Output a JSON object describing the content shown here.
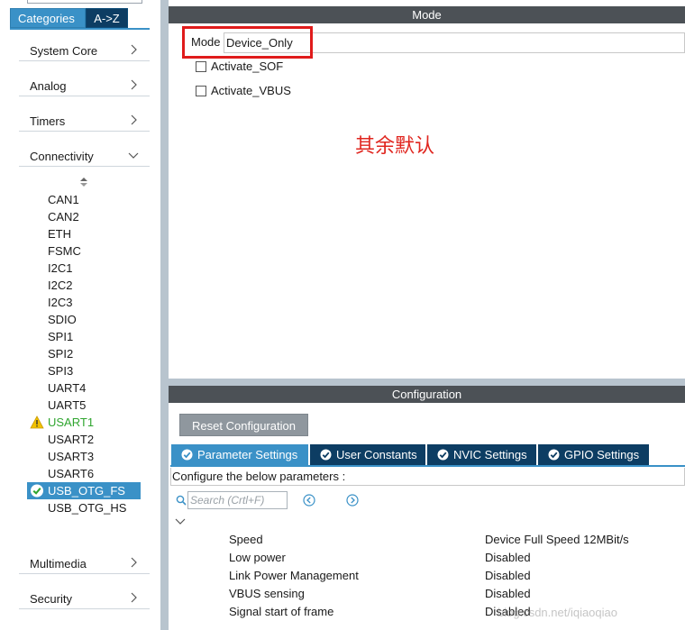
{
  "left_panel": {
    "tabs": {
      "categories": "Categories",
      "az": "A->Z"
    },
    "groups": {
      "system_core": "System Core",
      "analog": "Analog",
      "timers": "Timers",
      "connectivity": "Connectivity",
      "multimedia": "Multimedia",
      "security": "Security"
    },
    "peripherals": [
      "CAN1",
      "CAN2",
      "ETH",
      "FSMC",
      "I2C1",
      "I2C2",
      "I2C3",
      "SDIO",
      "SPI1",
      "SPI2",
      "SPI3",
      "UART4",
      "UART5",
      "USART1",
      "USART2",
      "USART3",
      "USART6",
      "USB_OTG_FS",
      "USB_OTG_HS"
    ],
    "peripheral_states": {
      "USART1": "warning",
      "USB_OTG_FS": "selected-enabled"
    }
  },
  "mode_panel": {
    "header": "Mode",
    "mode_label": "Mode",
    "mode_value": "Device_Only",
    "checkboxes": [
      "Activate_SOF",
      "Activate_VBUS"
    ],
    "annotation": "其余默认"
  },
  "config_panel": {
    "header": "Configuration",
    "reset_button": "Reset Configuration",
    "tabs": [
      "Parameter Settings",
      "User Constants",
      "NVIC Settings",
      "GPIO Settings"
    ],
    "active_tab": "Parameter Settings",
    "description": "Configure the below parameters :",
    "search_placeholder": "Search (Crtl+F)",
    "parameters": [
      {
        "name": "Speed",
        "value": "Device Full Speed 12MBit/s"
      },
      {
        "name": "Low power",
        "value": "Disabled"
      },
      {
        "name": "Link Power Management",
        "value": "Disabled"
      },
      {
        "name": "VBUS sensing",
        "value": "Disabled"
      },
      {
        "name": "Signal start of frame",
        "value": "Disabled"
      }
    ]
  },
  "watermark": "blog.csdn.net/iqiaoqiao",
  "colors": {
    "accent_blue": "#3a91c7",
    "dark_navy": "#0d3d63",
    "panel_header": "#4c5156",
    "annotation_red": "#e0261f",
    "warning_green": "#2fa52f"
  },
  "icons": {
    "group_collapsed": "chevron-right-icon",
    "group_expanded": "chevron-down-icon",
    "sort": "sort-icon",
    "warning": "warning-triangle-icon",
    "enabled": "check-circle-icon",
    "search": "search-icon",
    "prev": "prev-arrow-icon",
    "next": "next-arrow-icon"
  }
}
